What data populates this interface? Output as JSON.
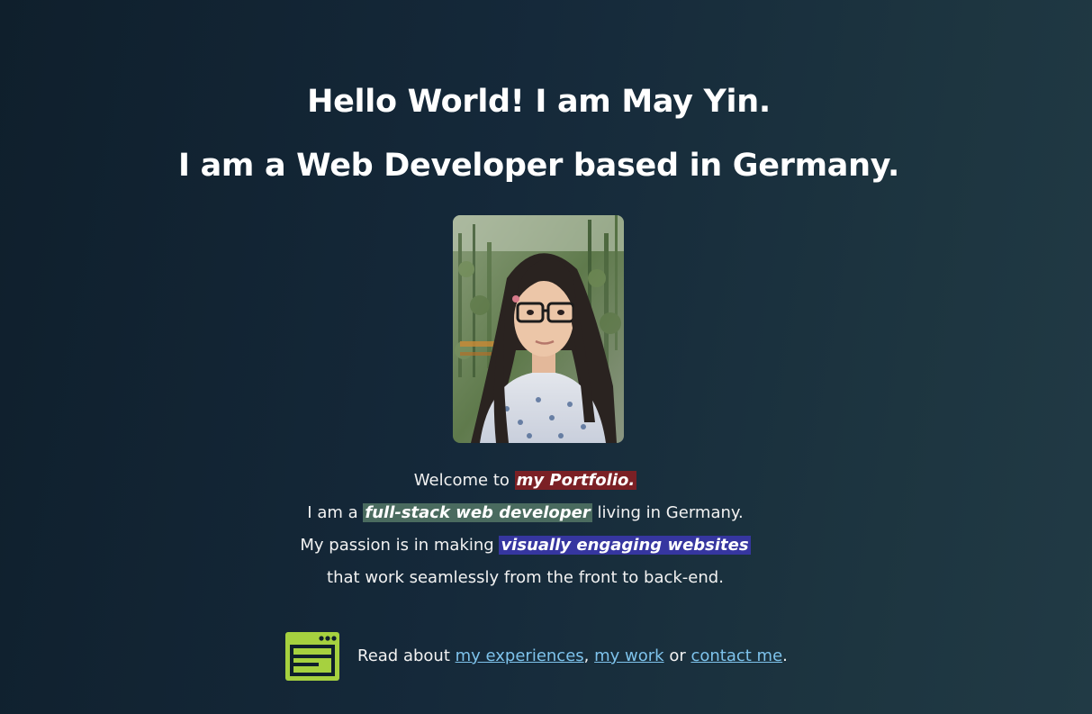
{
  "header": {
    "line1": "Hello World! I am May Yin.",
    "line2": "I am a Web Developer based in Germany."
  },
  "intro": {
    "l1_pre": "Welcome to ",
    "l1_highlight": "my Portfolio.",
    "l2_pre": "I am a ",
    "l2_highlight": "full-stack web developer",
    "l2_post": " living in Germany.",
    "l3_pre": "My passion is in making ",
    "l3_highlight": "visually engaging websites",
    "l4": "that work seamlessly from the front to back-end."
  },
  "cta": {
    "icon": "browser-window-icon",
    "prefix": "Read about ",
    "link_experiences": "my experiences",
    "sep1": ", ",
    "link_work": "my work",
    "sep2": " or ",
    "link_contact": "contact me",
    "suffix": "."
  },
  "colors": {
    "background_start": "#0f1f2c",
    "background_end": "#213a45",
    "highlight_red": "#7b2025",
    "highlight_green": "#4a6b5f",
    "highlight_blue": "#3636a0",
    "link": "#7ec3ec",
    "icon_green": "#a6d13f"
  }
}
